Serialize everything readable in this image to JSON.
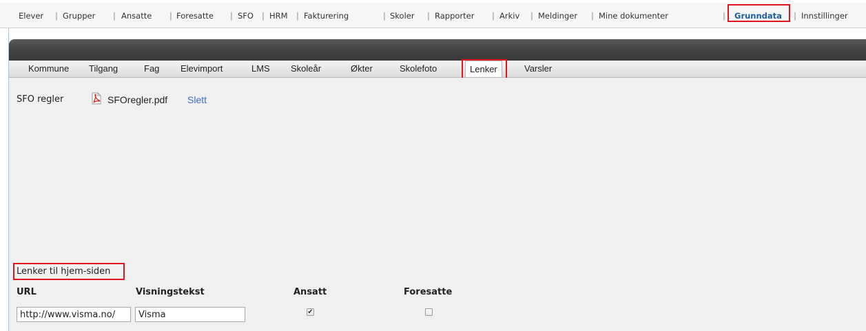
{
  "nav": {
    "items": [
      "Elever",
      "Grupper",
      "Ansatte",
      "Foresatte",
      "SFO",
      "HRM",
      "Fakturering",
      "Skoler",
      "Rapporter",
      "Arkiv",
      "Meldinger",
      "Mine dokumenter",
      "Grunndata",
      "Innstillinger"
    ],
    "active": "Grunndata",
    "active_color": "#1d5e9c"
  },
  "tabs": {
    "items": [
      "Kommune",
      "Tilgang",
      "Fag",
      "Elevimport",
      "LMS",
      "Skoleår",
      "Økter",
      "Skolefoto",
      "Lenker",
      "Varsler"
    ],
    "active": "Lenker"
  },
  "files": {
    "label": "SFO regler",
    "file_name": "SFOregler.pdf",
    "file_icon": "pdf-icon",
    "delete_label": "Slett"
  },
  "links": {
    "section_title": "Lenker til hjem-siden",
    "columns": [
      "URL",
      "Visningstekst",
      "Ansatt",
      "Foresatte"
    ],
    "rows": [
      {
        "url": "http://www.visma.no/",
        "display_text": "Visma",
        "ansatt": true,
        "foresatte": false
      }
    ]
  },
  "highlight_color": "#e0141e",
  "link_color": "#3a6fc0"
}
